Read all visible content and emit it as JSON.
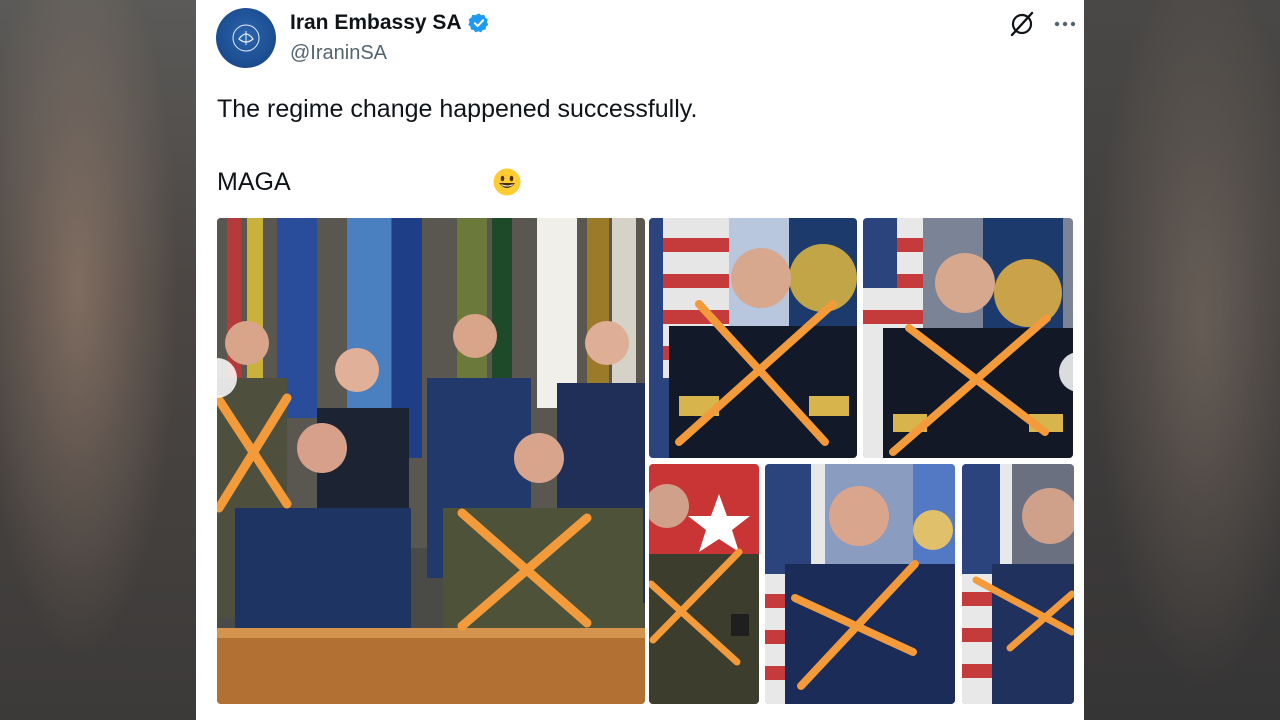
{
  "tweet": {
    "display_name": "Iran Embassy SA",
    "handle": "@IraninSA",
    "text_line1": "The regime change happened successfully.",
    "text_line2": "MAGA",
    "emoji": "grinning-face"
  },
  "icons": {
    "verified": "verified-badge-icon",
    "grok": "grok-icon",
    "more": "more-options-icon"
  },
  "colors": {
    "verified_blue": "#1d9bf0",
    "avatar_blue": "#1d4f93",
    "cross_orange": "#f39a3b"
  }
}
